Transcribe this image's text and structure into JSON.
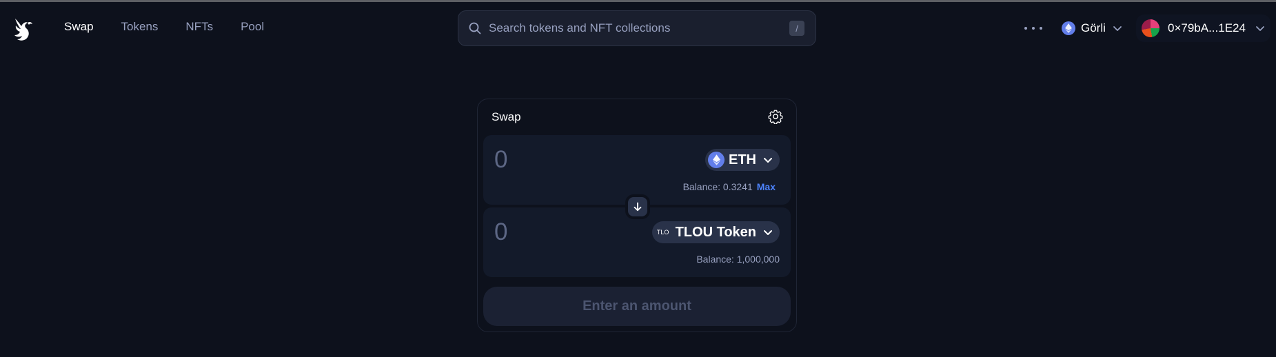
{
  "nav": {
    "links": [
      {
        "label": "Swap",
        "active": true
      },
      {
        "label": "Tokens",
        "active": false
      },
      {
        "label": "NFTs",
        "active": false
      },
      {
        "label": "Pool",
        "active": false
      }
    ],
    "logo_icon": "uniswap-unicorn-icon"
  },
  "search": {
    "placeholder": "Search tokens and NFT collections",
    "shortcut": "/"
  },
  "network": {
    "label": "Görli",
    "icon": "ethereum-icon"
  },
  "account": {
    "label": "0×79bA...1E24"
  },
  "swap": {
    "title": "Swap",
    "input": {
      "amount_placeholder": "0",
      "token": "ETH",
      "balance": "Balance: 0.3241",
      "max_label": "Max"
    },
    "output": {
      "amount_placeholder": "0",
      "token_logo_text": "TLO",
      "token": "TLOU Token",
      "balance": "Balance: 1,000,000"
    },
    "cta_label": "Enter an amount"
  },
  "colors": {
    "background": "#0d111c",
    "panel": "#131a2a",
    "accent": "#4c82fb",
    "muted_text": "#98a1c0"
  }
}
